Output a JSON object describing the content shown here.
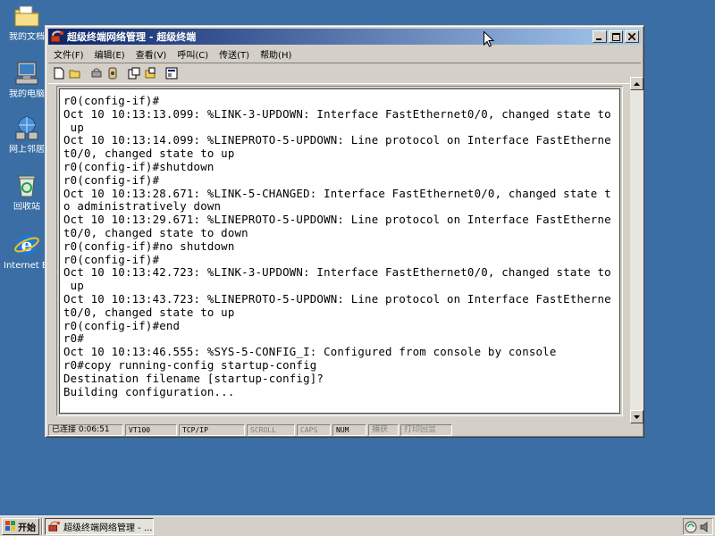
{
  "desktop": {
    "icons": [
      {
        "label": "我的文档"
      },
      {
        "label": "我的电脑"
      },
      {
        "label": "网上邻居"
      },
      {
        "label": "回收站"
      },
      {
        "label": "Internet Explorer"
      }
    ]
  },
  "window": {
    "title": "超级终端网络管理 - 超级终端",
    "menu": [
      {
        "label": "文件(F)"
      },
      {
        "label": "编辑(E)"
      },
      {
        "label": "查看(V)"
      },
      {
        "label": "呼叫(C)"
      },
      {
        "label": "传送(T)"
      },
      {
        "label": "帮助(H)"
      }
    ],
    "toolbar_icons": [
      "new-icon",
      "open-icon",
      "disconnect-icon",
      "dial-icon",
      "send-icon",
      "receive-icon",
      "properties-icon"
    ]
  },
  "terminal": {
    "lines": [
      "r0(config-if)#",
      "Oct 10 10:13:13.099: %LINK-3-UPDOWN: Interface FastEthernet0/0, changed state to",
      " up",
      "Oct 10 10:13:14.099: %LINEPROTO-5-UPDOWN: Line protocol on Interface FastEtherne",
      "t0/0, changed state to up",
      "r0(config-if)#shutdown",
      "r0(config-if)#",
      "Oct 10 10:13:28.671: %LINK-5-CHANGED: Interface FastEthernet0/0, changed state t",
      "o administratively down",
      "Oct 10 10:13:29.671: %LINEPROTO-5-UPDOWN: Line protocol on Interface FastEtherne",
      "t0/0, changed state to down",
      "r0(config-if)#no shutdown",
      "r0(config-if)#",
      "Oct 10 10:13:42.723: %LINK-3-UPDOWN: Interface FastEthernet0/0, changed state to",
      " up",
      "Oct 10 10:13:43.723: %LINEPROTO-5-UPDOWN: Line protocol on Interface FastEtherne",
      "t0/0, changed state to up",
      "r0(config-if)#end",
      "r0#",
      "Oct 10 10:13:46.555: %SYS-5-CONFIG_I: Configured from console by console",
      "r0#copy running-config startup-config",
      "Destination filename [startup-config]?",
      "Building configuration..."
    ]
  },
  "status": {
    "connected": "已连接 0:06:51",
    "emulation": "VT100",
    "protocol": "TCP/IP",
    "scroll": "SCROLL",
    "caps": "CAPS",
    "num": "NUM",
    "capture": "捕获",
    "print_echo": "打印回显"
  },
  "taskbar": {
    "start_label": "开始",
    "task_label": "超级终端网络管理 - ..."
  },
  "colors": {
    "desktop": "#3a6ea5",
    "titlebar_start": "#0a246a",
    "titlebar_end": "#a6caf0",
    "chrome": "#d4d0c8"
  }
}
